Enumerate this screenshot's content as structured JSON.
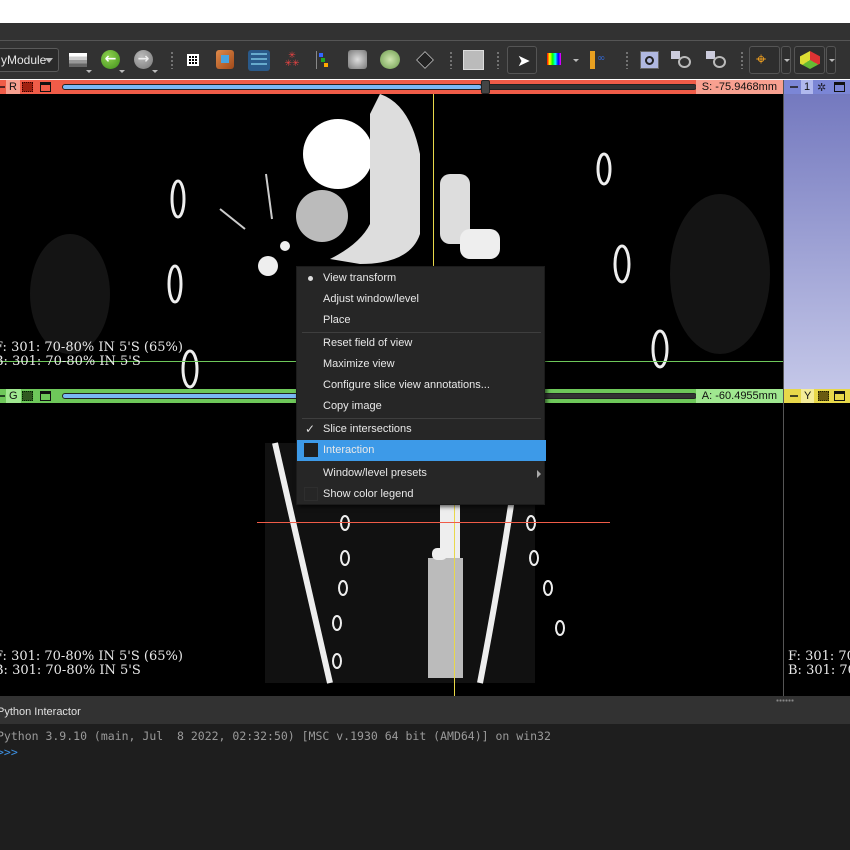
{
  "toolbar": {
    "module_selector": "yModule",
    "icons": [
      "layout-stack-icon",
      "back-arrow-icon",
      "forward-arrow-icon",
      "grid-icon",
      "extension-cube-icon",
      "scripted-loadable-template-icon",
      "markups-icon",
      "data-tree-icon",
      "volume-cube-icon",
      "volume-rendering-icon",
      "transforms-icon",
      "layout-select-icon",
      "pointer-icon",
      "colorbar-icon",
      "ruler-icon",
      "screenshot-icon",
      "scene-view-icon",
      "capture-icon",
      "crosshair-icon",
      "slice-intersection-icon"
    ]
  },
  "views": {
    "red": {
      "label": "R",
      "offset": "S: -75.9468mm",
      "slider_fraction": 0.66,
      "annotation_line1": "F: 301: 70-80% IN 5'S (65%)",
      "annotation_line2": "B: 301: 70-80% IN 5'S",
      "color": "#f05c48"
    },
    "green": {
      "label": "G",
      "offset": "A: -60.4955mm",
      "slider_fraction": 0.66,
      "annotation_line1": "F: 301: 70-80% IN 5'S (65%)",
      "annotation_line2": "B: 301: 70-80% IN 5'S",
      "color": "#6ec85a"
    },
    "threed": {
      "label": "1",
      "color": "#7b86d6"
    },
    "yellow": {
      "label": "Y",
      "annotation_line1": "F: 301: 70",
      "annotation_line2": "B: 301: 70",
      "color": "#e8d84a"
    }
  },
  "context_menu": {
    "items": [
      {
        "label": "View transform",
        "state": "radio-selected"
      },
      {
        "label": "Adjust window/level",
        "state": "none"
      },
      {
        "label": "Place",
        "state": "none"
      },
      {
        "label": "Reset field of view",
        "state": "none"
      },
      {
        "label": "Maximize view",
        "state": "none"
      },
      {
        "label": "Configure slice view annotations...",
        "state": "none"
      },
      {
        "label": "Copy image",
        "state": "none"
      },
      {
        "label": "Slice intersections",
        "state": "checked"
      },
      {
        "label": "Interaction",
        "state": "unchecked-highlighted"
      },
      {
        "label": "Window/level presets",
        "state": "submenu"
      },
      {
        "label": "Show color legend",
        "state": "unchecked"
      }
    ]
  },
  "python_console": {
    "title": "Python Interactor",
    "banner": "Python 3.9.10 (main, Jul  8 2022, 02:32:50) [MSC v.1930 64 bit (AMD64)] on win32",
    "prompt": ">>>"
  }
}
